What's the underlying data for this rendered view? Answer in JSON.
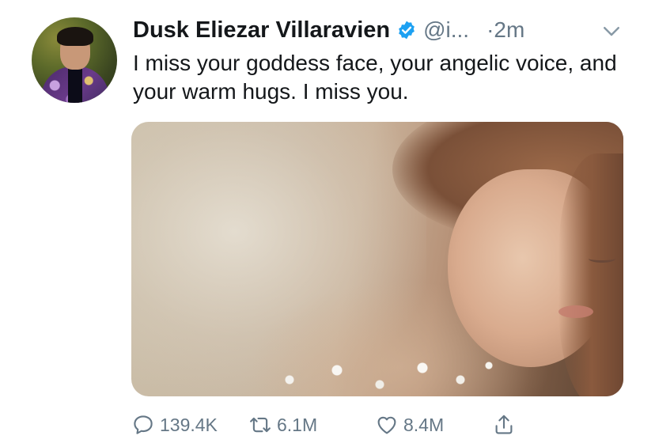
{
  "tweet": {
    "author_name": "Dusk Eliezar Villaravien",
    "handle": "@i...",
    "timestamp": "·2m",
    "text": "I miss your goddess face, your angelic voice, and your warm hugs. I miss you.",
    "verified": true,
    "media_description_icon": "photo"
  },
  "actions": {
    "reply_count": "139.4K",
    "retweet_count": "6.1M",
    "like_count": "8.4M"
  },
  "icons": {
    "reply": "reply-bubble-icon",
    "retweet": "retweet-icon",
    "like": "heart-icon",
    "share": "share-icon",
    "verified": "verified-badge-icon",
    "caret": "chevron-down-icon"
  },
  "colors": {
    "text": "#14171a",
    "secondary": "#657786",
    "verified": "#1da1f2"
  }
}
